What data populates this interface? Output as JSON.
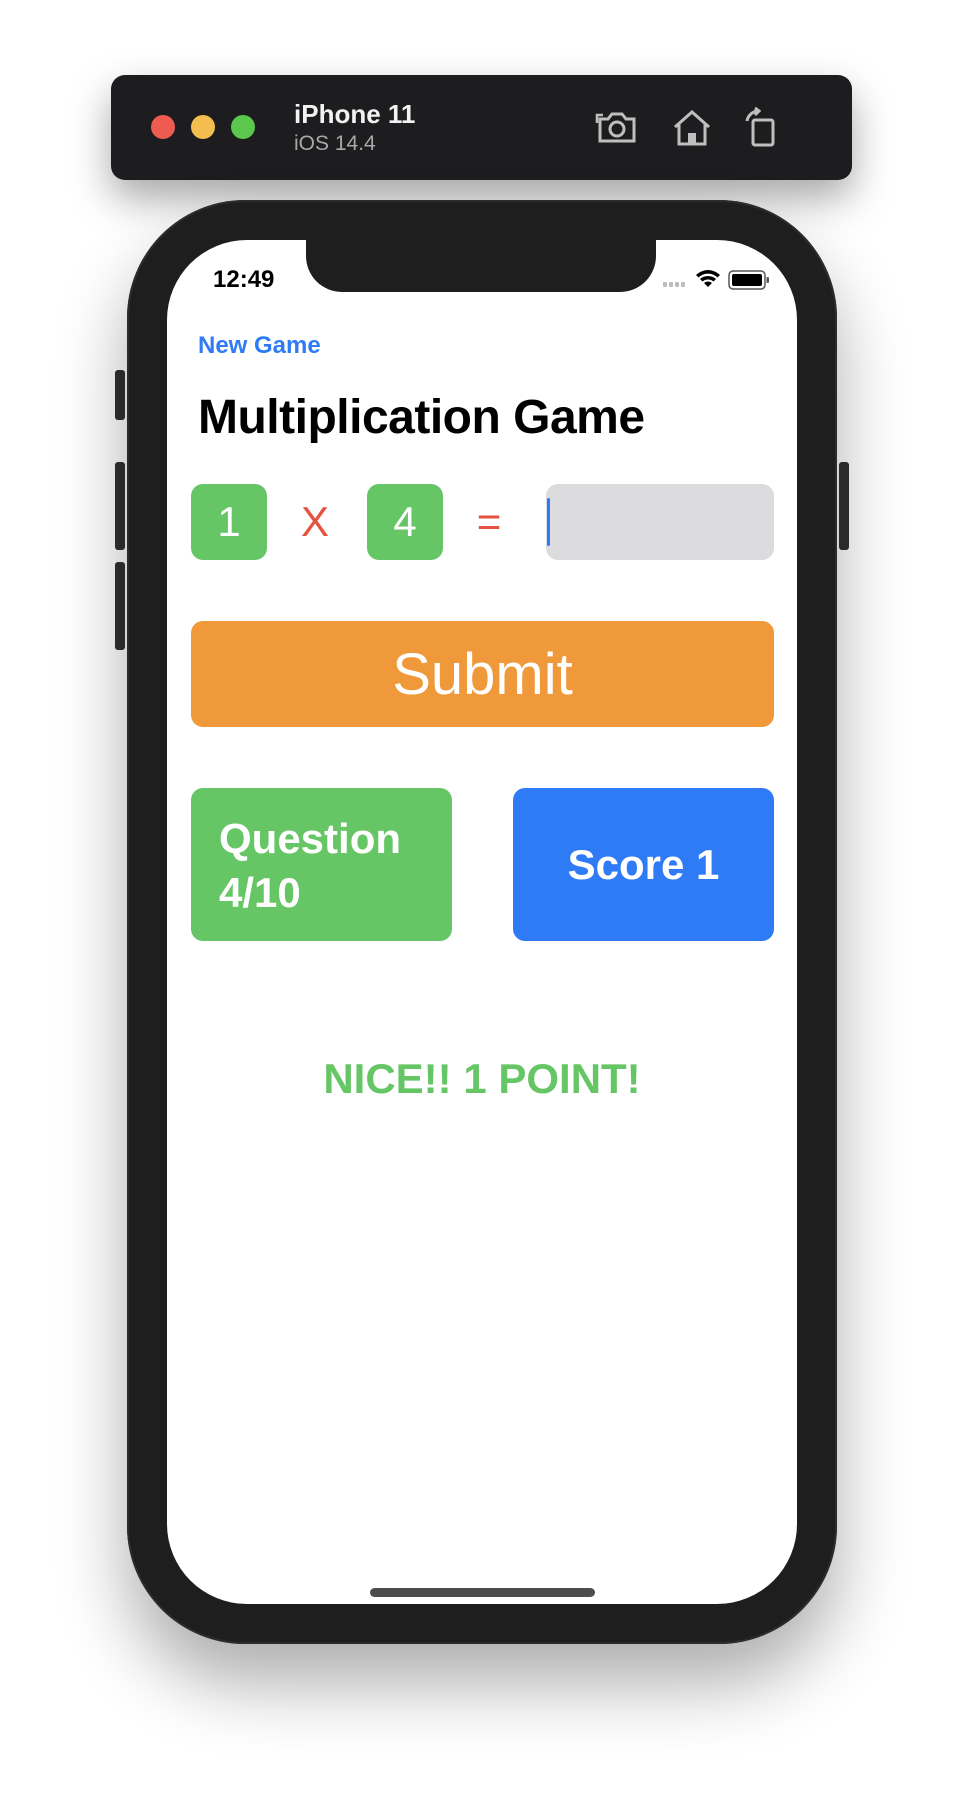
{
  "simulator": {
    "device_name": "iPhone 11",
    "os_version": "iOS 14.4",
    "icons": [
      "screenshot-icon",
      "home-icon",
      "rotate-icon"
    ]
  },
  "status_bar": {
    "time": "12:49",
    "icons": [
      "signal-icon",
      "wifi-icon",
      "battery-icon"
    ]
  },
  "nav": {
    "new_game_label": "New Game",
    "title": "Multiplication Game"
  },
  "equation": {
    "left": "1",
    "operator": "X",
    "right": "4",
    "equals": "=",
    "answer_value": ""
  },
  "submit_label": "Submit",
  "question_card": {
    "line1": "Question",
    "line2": "4/10"
  },
  "score_label": "Score 1",
  "feedback": "NICE!! 1 POINT!",
  "colors": {
    "green": "#66c666",
    "orange": "#f0993a",
    "blue": "#2f7bf6",
    "red": "#e5533f",
    "input_bg": "#dcdcdf"
  }
}
